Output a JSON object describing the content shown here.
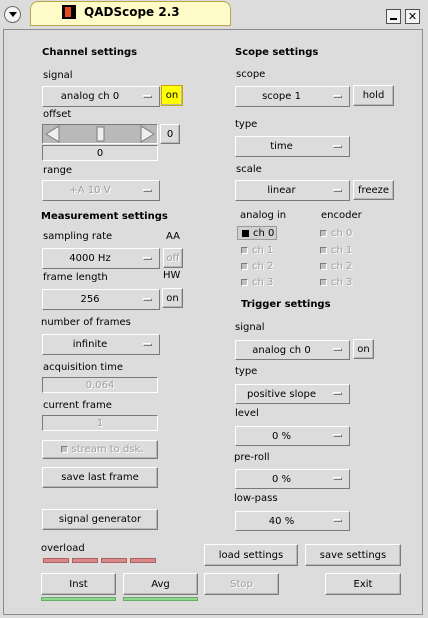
{
  "window": {
    "title": "QADScope 2.3",
    "close_glyph": "✕"
  },
  "channel": {
    "heading": "Channel settings",
    "signal_label": "signal",
    "signal_value": "analog ch 0",
    "on_label": "on",
    "offset_label": "offset",
    "offset_button": "0",
    "offset_value": "0",
    "range_label": "range",
    "range_value": "+A 10 V"
  },
  "measurement": {
    "heading": "Measurement settings",
    "sampling_label": "sampling rate",
    "aa_label": "AA",
    "sampling_value": "4000 Hz",
    "aa_button": "off",
    "frame_length_label": "frame length",
    "hw_label": "HW",
    "frame_length_value": "256",
    "hw_button": "on",
    "frames_label": "number of frames",
    "frames_value": "infinite",
    "acq_label": "acquisition time",
    "acq_value": "0.064",
    "current_label": "current frame",
    "current_value": "1",
    "stream_label": "stream to dsk.",
    "save_last": "save last frame",
    "siggen": "signal generator",
    "overload_label": "overload"
  },
  "scope": {
    "heading": "Scope settings",
    "scope_label": "scope",
    "scope_value": "scope 1",
    "hold": "hold",
    "type_label": "type",
    "type_value": "time",
    "scale_label": "scale",
    "scale_value": "linear",
    "freeze": "freeze",
    "analog_label": "analog in",
    "encoder_label": "encoder",
    "analog": [
      "ch 0",
      "ch 1",
      "ch 2",
      "ch 3"
    ],
    "encoder": [
      "ch 0",
      "ch 1",
      "ch 2",
      "ch 3"
    ]
  },
  "trigger": {
    "heading": "Trigger settings",
    "signal_label": "signal",
    "signal_value": "analog ch 0",
    "on_label": "on",
    "type_label": "type",
    "type_value": "positive slope",
    "level_label": "level",
    "level_value": "0 %",
    "preroll_label": "pre-roll",
    "preroll_value": "0 %",
    "lowpass_label": "low-pass",
    "lowpass_value": "40 %"
  },
  "buttons": {
    "load": "load settings",
    "save": "save settings",
    "inst": "Inst",
    "avg": "Avg",
    "stop": "Stop",
    "exit": "Exit"
  },
  "colors": {
    "on_highlight": "#ffff00",
    "led_off": "#d88a8a",
    "run_green": "#8ed58e"
  }
}
